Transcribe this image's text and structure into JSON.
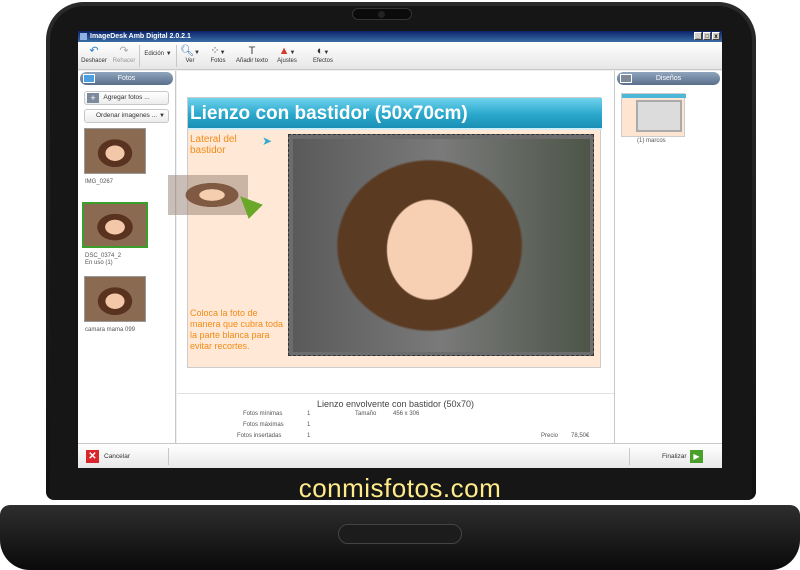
{
  "brand": "conmisfotos.com",
  "window": {
    "title": "ImageDesk Amb Digital 2.0.2.1",
    "min": "_",
    "max": "□",
    "close": "x"
  },
  "toolbar": {
    "undo": "Deshacer",
    "redo": "Rehacer",
    "edit": "Edición",
    "view": "Ver",
    "photos": "Fotos",
    "add_text": "Añadir texto",
    "adjust": "Ajustes",
    "effects": "Efectos",
    "text_glyph": "T"
  },
  "left": {
    "header": "Fotos",
    "add_photos": "Agregar fotos ...",
    "sort_images": "Ordenar imagenes ...",
    "photos": [
      {
        "caption": "IMG_0267"
      },
      {
        "caption": "DSC_0374_2",
        "status": "En uso (1)"
      },
      {
        "caption": "camara mama 099"
      }
    ]
  },
  "right": {
    "header": "Diseños",
    "design_caption": "(1) marcos"
  },
  "canvas": {
    "title": "Lienzo con bastidor (50x70cm)",
    "side_label": "Lateral del bastidor",
    "hint": "Coloca la foto de manera que cubra toda la parte blanca para evitar recortes.",
    "arrow": "➤"
  },
  "info": {
    "product": "Lienzo envolvente con bastidor (50x70)",
    "min_photos_label": "Fotos mínimas",
    "min_photos": "1",
    "size_label": "Tamaño",
    "size": "456 x 306",
    "max_photos_label": "Fotos máximas",
    "max_photos": "1",
    "inserted_label": "Fotos insertadas",
    "inserted": "1",
    "price_label": "Precio",
    "price": "78,50€"
  },
  "footer": {
    "cancel": "Cancelar",
    "finish": "Finalizar"
  },
  "colors": {
    "accent": "#2aa8cc",
    "hint_orange": "#f28a16",
    "selected_green": "#3aa02a",
    "cancel_red": "#d8262a"
  }
}
